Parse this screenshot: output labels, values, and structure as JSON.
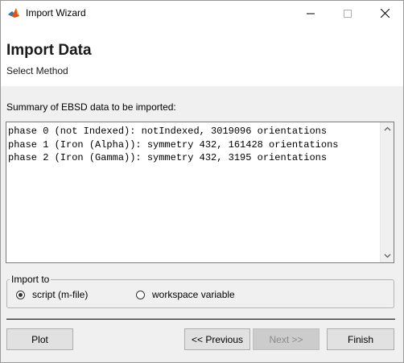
{
  "window": {
    "title": "Import Wizard",
    "app_icon": "matlab-icon",
    "controls": {
      "minimize": "minimize-icon",
      "maximize": "maximize-icon",
      "close": "close-icon"
    }
  },
  "header": {
    "title": "Import Data",
    "subtitle": "Select Method"
  },
  "summary": {
    "label": "Summary of EBSD data to be imported:",
    "text": "phase 0 (not Indexed): notIndexed, 3019096 orientations\nphase 1 (Iron (Alpha)): symmetry 432, 161428 orientations\nphase 2 (Iron (Gamma)): symmetry 432, 3195 orientations"
  },
  "import_to": {
    "legend": "Import to",
    "options": [
      {
        "label": "script (m-file)",
        "selected": true
      },
      {
        "label": "workspace variable",
        "selected": false
      }
    ]
  },
  "buttons": {
    "plot": "Plot",
    "previous": "<< Previous",
    "next": "Next >>",
    "finish": "Finish"
  },
  "colors": {
    "background": "#f0f0f0",
    "header_background": "#ffffff",
    "disabled_text": "#8a8a8a"
  }
}
